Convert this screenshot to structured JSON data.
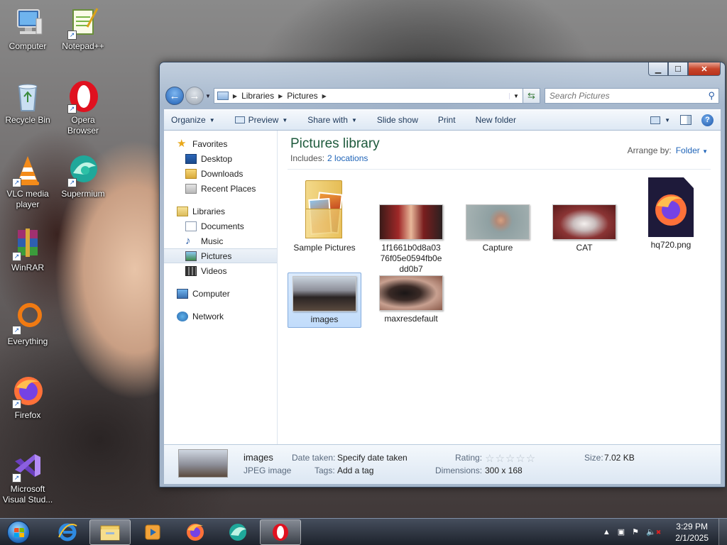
{
  "desktop": {
    "icons": [
      {
        "label": "Computer",
        "icon": "computer-icon"
      },
      {
        "label": "Notepad++",
        "icon": "notepadpp-icon"
      },
      {
        "label": "Recycle Bin",
        "icon": "recycle-bin-icon"
      },
      {
        "label": "Opera Browser",
        "icon": "opera-icon"
      },
      {
        "label": "VLC media player",
        "icon": "vlc-icon"
      },
      {
        "label": "Supermium",
        "icon": "supermium-icon"
      },
      {
        "label": "WinRAR",
        "icon": "winrar-icon"
      },
      {
        "label": "Everything",
        "icon": "everything-icon"
      },
      {
        "label": "Firefox",
        "icon": "firefox-icon"
      },
      {
        "label": "Microsoft Visual Stud...",
        "icon": "visual-studio-icon"
      }
    ]
  },
  "window": {
    "breadcrumb": [
      "Libraries",
      "Pictures"
    ],
    "search_placeholder": "Search Pictures",
    "toolbar": {
      "organize": "Organize",
      "preview": "Preview",
      "share_with": "Share with",
      "slide_show": "Slide show",
      "print": "Print",
      "new_folder": "New folder"
    },
    "nav": {
      "favorites": "Favorites",
      "desktop": "Desktop",
      "downloads": "Downloads",
      "recent_places": "Recent Places",
      "libraries": "Libraries",
      "documents": "Documents",
      "music": "Music",
      "pictures": "Pictures",
      "videos": "Videos",
      "computer": "Computer",
      "network": "Network"
    },
    "library": {
      "title": "Pictures library",
      "includes_label": "Includes:",
      "includes_link": "2 locations",
      "arrange_label": "Arrange by:",
      "arrange_value": "Folder"
    },
    "items": [
      {
        "name": "Sample Pictures",
        "type": "folder"
      },
      {
        "name": "1f1661b0d8a0376f05e0594fb0edd0b7",
        "type": "image"
      },
      {
        "name": "Capture",
        "type": "image"
      },
      {
        "name": "CAT",
        "type": "image"
      },
      {
        "name": "hq720.png",
        "type": "firefox-file"
      },
      {
        "name": "images",
        "type": "image",
        "selected": true
      },
      {
        "name": "maxresdefault",
        "type": "image"
      }
    ],
    "details": {
      "name": "images",
      "type": "JPEG image",
      "date_taken_label": "Date taken:",
      "date_taken_value": "Specify date taken",
      "tags_label": "Tags:",
      "tags_value": "Add a tag",
      "rating_label": "Rating:",
      "rating_stars": 0,
      "dimensions_label": "Dimensions:",
      "dimensions_value": "300 x 168",
      "size_label": "Size:",
      "size_value": "7.02 KB"
    }
  },
  "taskbar": {
    "apps": [
      "internet-explorer-icon",
      "windows-explorer-icon",
      "media-player-icon",
      "firefox-icon",
      "supermium-icon",
      "opera-icon"
    ],
    "clock_time": "3:29 PM",
    "clock_date": "2/1/2025"
  }
}
